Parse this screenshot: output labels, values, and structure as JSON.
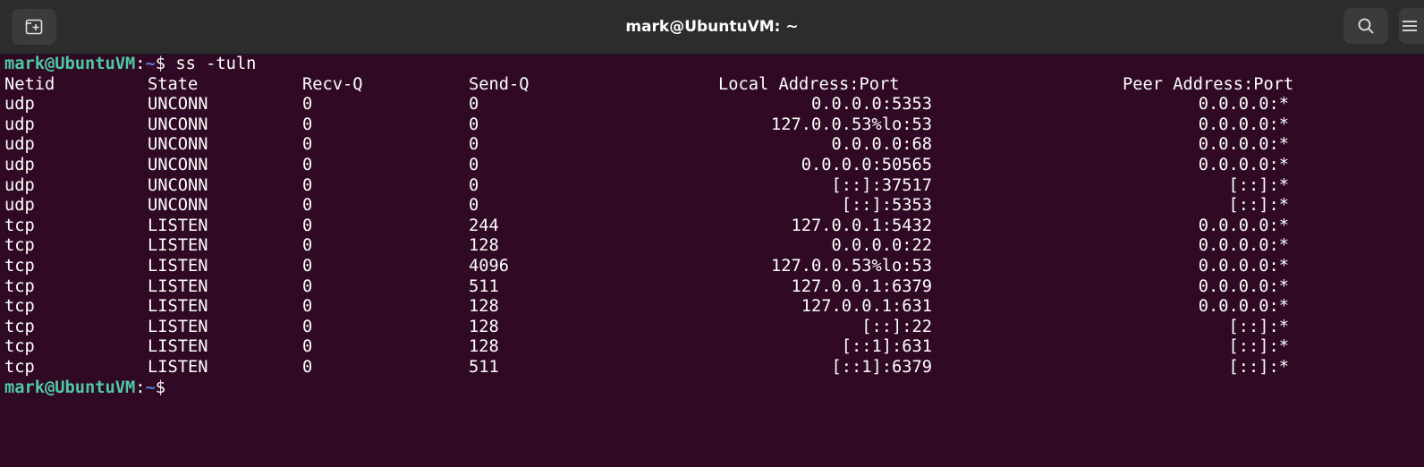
{
  "window": {
    "title": "mark@UbuntuVM: ~"
  },
  "prompt": {
    "user_host": "mark@UbuntuVM",
    "colon": ":",
    "path": "~",
    "symbol": "$",
    "command": " ss -tuln"
  },
  "table": {
    "headers": {
      "netid": "Netid",
      "state": "State",
      "recv": "Recv-Q",
      "send": "Send-Q",
      "local": "Local Address:Port",
      "peer": "Peer Address:Port"
    },
    "rows": [
      {
        "netid": "udp",
        "state": "UNCONN",
        "recv": "0",
        "send": "0",
        "local": "0.0.0.0:5353",
        "peer": "0.0.0.0:*"
      },
      {
        "netid": "udp",
        "state": "UNCONN",
        "recv": "0",
        "send": "0",
        "local": "127.0.0.53%lo:53",
        "peer": "0.0.0.0:*"
      },
      {
        "netid": "udp",
        "state": "UNCONN",
        "recv": "0",
        "send": "0",
        "local": "0.0.0.0:68",
        "peer": "0.0.0.0:*"
      },
      {
        "netid": "udp",
        "state": "UNCONN",
        "recv": "0",
        "send": "0",
        "local": "0.0.0.0:50565",
        "peer": "0.0.0.0:*"
      },
      {
        "netid": "udp",
        "state": "UNCONN",
        "recv": "0",
        "send": "0",
        "local": "[::]:37517",
        "peer": "[::]:*"
      },
      {
        "netid": "udp",
        "state": "UNCONN",
        "recv": "0",
        "send": "0",
        "local": "[::]:5353",
        "peer": "[::]:*"
      },
      {
        "netid": "tcp",
        "state": "LISTEN",
        "recv": "0",
        "send": "244",
        "local": "127.0.0.1:5432",
        "peer": "0.0.0.0:*"
      },
      {
        "netid": "tcp",
        "state": "LISTEN",
        "recv": "0",
        "send": "128",
        "local": "0.0.0.0:22",
        "peer": "0.0.0.0:*"
      },
      {
        "netid": "tcp",
        "state": "LISTEN",
        "recv": "0",
        "send": "4096",
        "local": "127.0.0.53%lo:53",
        "peer": "0.0.0.0:*"
      },
      {
        "netid": "tcp",
        "state": "LISTEN",
        "recv": "0",
        "send": "511",
        "local": "127.0.0.1:6379",
        "peer": "0.0.0.0:*"
      },
      {
        "netid": "tcp",
        "state": "LISTEN",
        "recv": "0",
        "send": "128",
        "local": "127.0.0.1:631",
        "peer": "0.0.0.0:*"
      },
      {
        "netid": "tcp",
        "state": "LISTEN",
        "recv": "0",
        "send": "128",
        "local": "[::]:22",
        "peer": "[::]:*"
      },
      {
        "netid": "tcp",
        "state": "LISTEN",
        "recv": "0",
        "send": "128",
        "local": "[::1]:631",
        "peer": "[::]:*"
      },
      {
        "netid": "tcp",
        "state": "LISTEN",
        "recv": "0",
        "send": "511",
        "local": "[::1]:6379",
        "peer": "[::]:*"
      }
    ]
  },
  "icons": {
    "new_tab": "new-tab-icon",
    "search": "search-icon",
    "menu": "hamburger-menu-icon"
  },
  "colors": {
    "terminal_bg": "#300a24",
    "titlebar_bg": "#2c2c2c",
    "prompt_user": "#4ec9a2",
    "prompt_path": "#5c7ce0"
  }
}
